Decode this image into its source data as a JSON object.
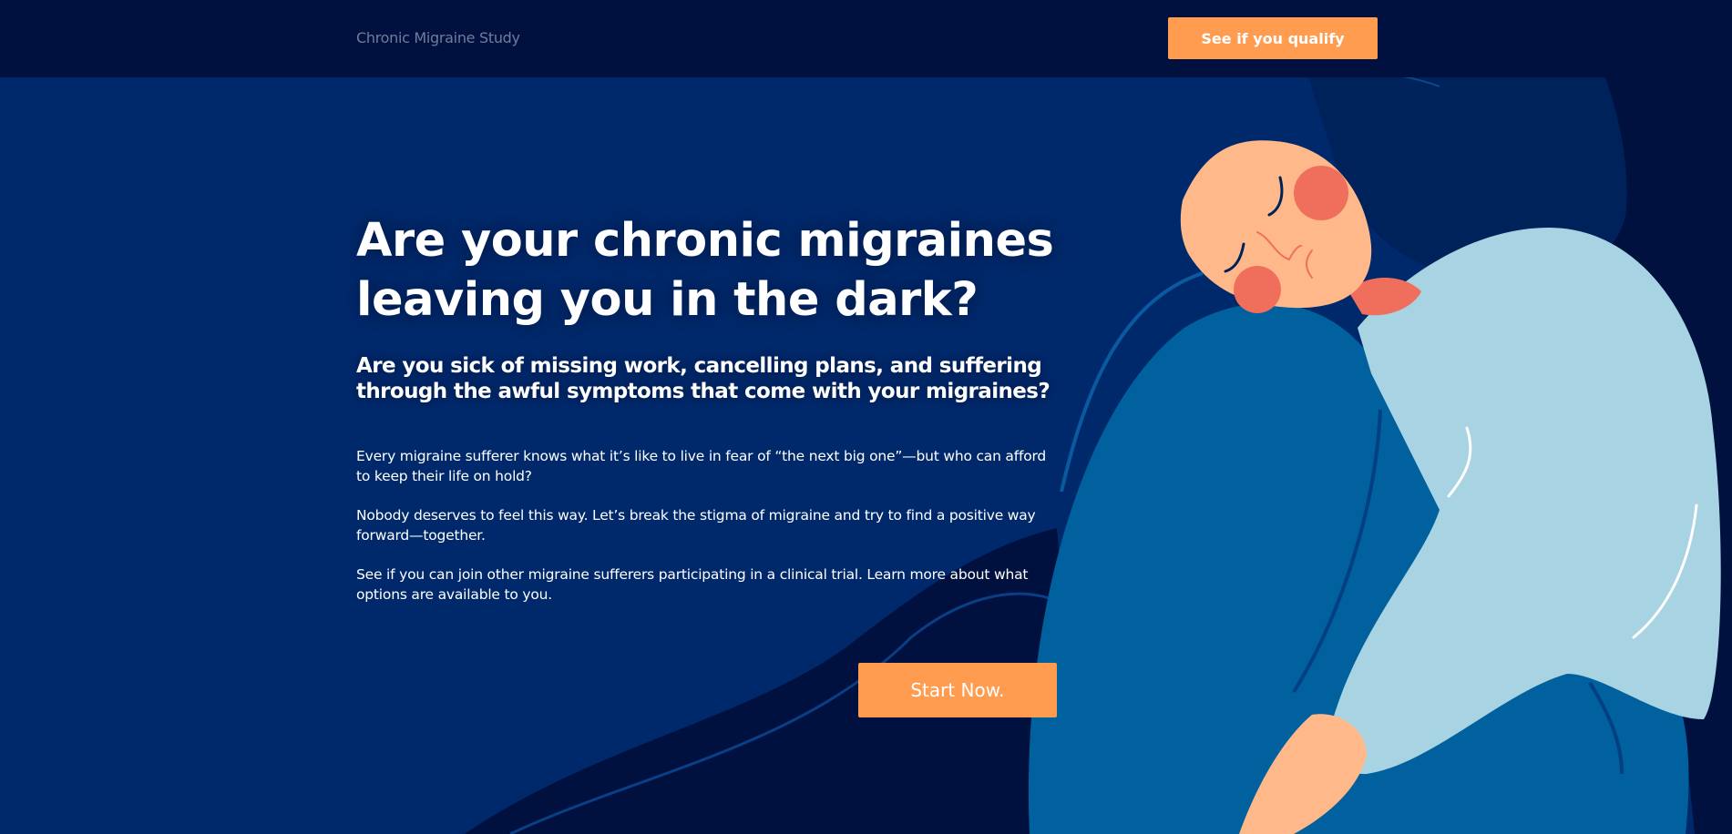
{
  "header": {
    "brand": "Chronic Migraine Study",
    "cta_label": "See if you qualify"
  },
  "hero": {
    "title": "Are your chronic migraines leaving you in the dark?",
    "subtitle": "Are you sick of missing work, cancelling plans, and suffering through the awful symptoms that come with your migraines?",
    "paragraphs": [
      "Every migraine sufferer knows what it’s like to live in fear of “the next big one”—but who can afford to keep their life on hold?",
      "Nobody deserves to feel this way. Let’s break the stigma of migraine and try to find a positive way forward—together.",
      "See if you can join other migraine sufferers participating in a clinical trial. Learn more about what options are available to you."
    ],
    "start_label": "Start Now."
  },
  "colors": {
    "navy_dark": "#00113f",
    "navy": "#00296b",
    "accent": "#ff9c4f",
    "sweater": "#a8d3e2",
    "pants": "#00619e",
    "skin": "#ffb88a",
    "cheek": "#ef6f5c"
  },
  "illustration": "sad-woman-illustration"
}
